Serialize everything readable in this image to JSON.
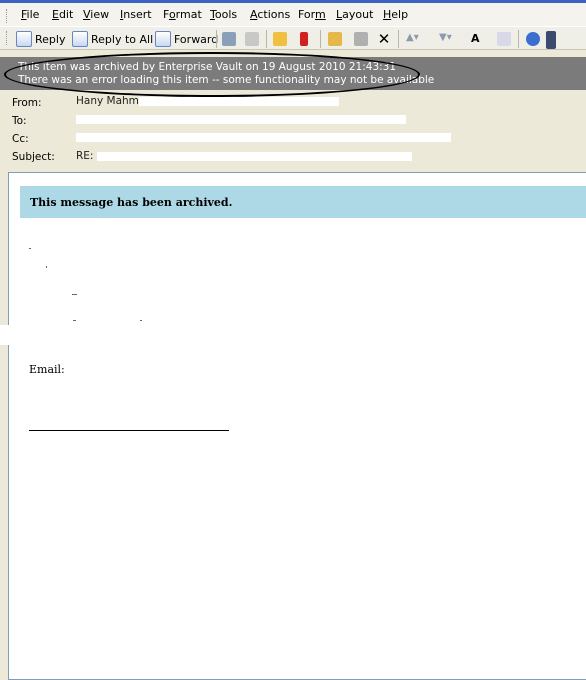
{
  "menu": [
    "File",
    "Edit",
    "View",
    "Insert",
    "Format",
    "Tools",
    "Actions",
    "Form",
    "Layout",
    "Help"
  ],
  "menu_underline": [
    "F",
    "E",
    "V",
    "I",
    "o",
    "T",
    "A",
    "m",
    "L",
    "H"
  ],
  "toolbar": {
    "reply": "Reply",
    "reply_all": "Reply to All",
    "forward": "Forward"
  },
  "infobar": {
    "line1": "This item was archived by Enterprise Vault on 19 August 2010 21:43:31",
    "line2": "There was an error loading this item -- some functionality may not be available"
  },
  "headers": {
    "from_label": "From:",
    "from_value": "Hany Mahm",
    "to_label": "To:",
    "cc_label": "Cc:",
    "subject_label": "Subject:",
    "subject_value": "RE:"
  },
  "body": {
    "archived_notice": "This message has been archived.",
    "email_label": "Email:"
  },
  "colors": {
    "infobar_bg": "#7b7b7b",
    "archived_bg": "#add8e6"
  }
}
